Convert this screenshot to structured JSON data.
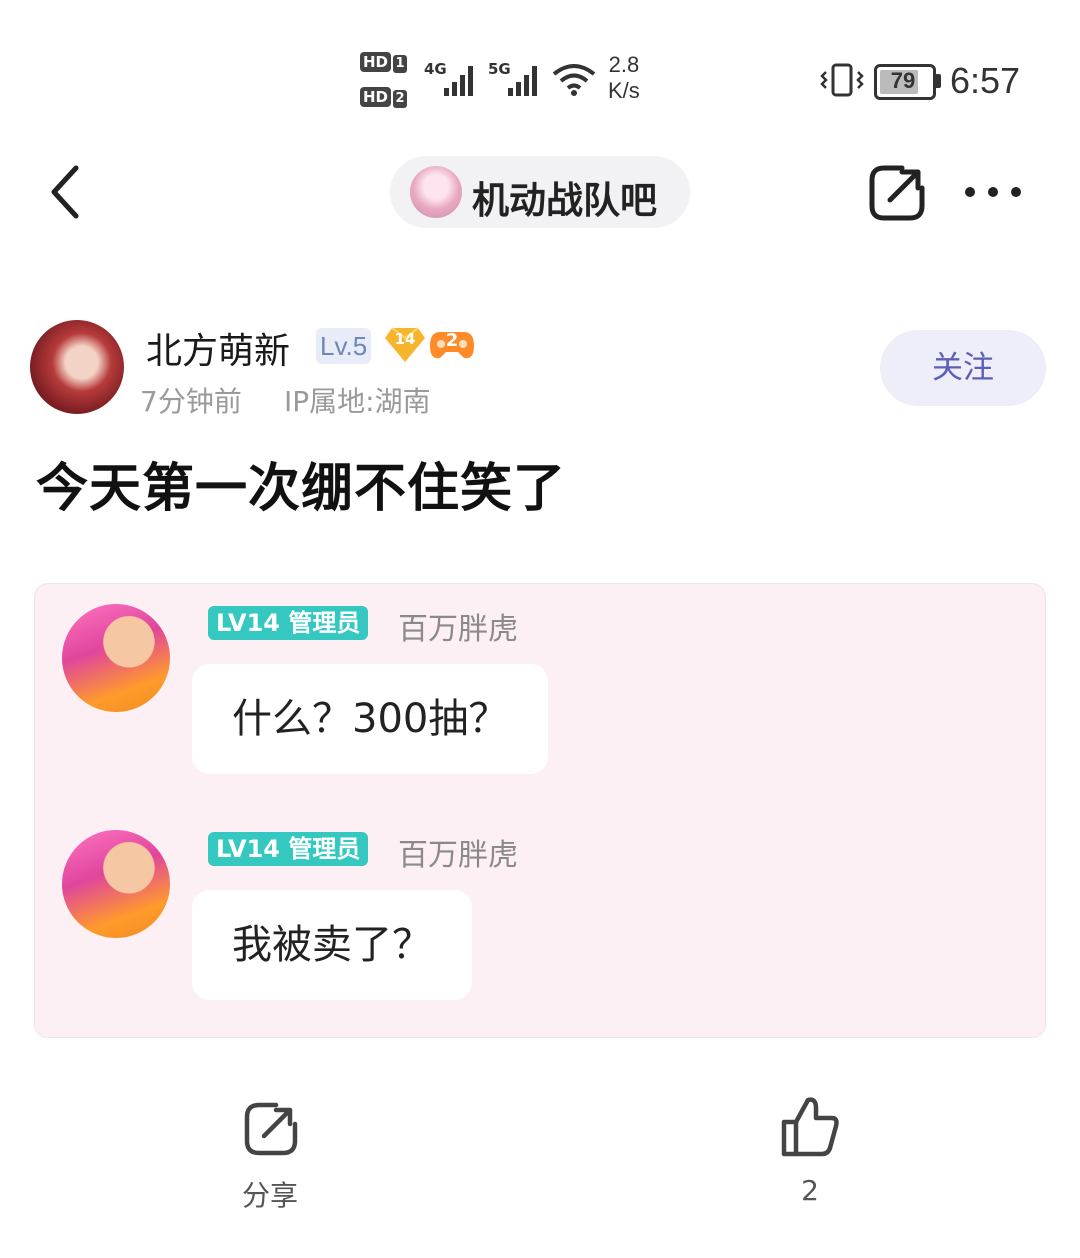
{
  "status_bar": {
    "hd1": "HD",
    "hd1_num": "1",
    "hd2": "HD",
    "hd2_num": "2",
    "net1": "4G",
    "net2": "5G",
    "speed_value": "2.8",
    "speed_unit": "K/s",
    "battery": "79",
    "time": "6:57"
  },
  "header": {
    "forum_name": "机动战队吧",
    "back_icon": "chevron-left-icon",
    "share_icon": "share-icon",
    "more_icon": "more-icon"
  },
  "post": {
    "author": "北方萌新",
    "level": "Lv.5",
    "gem_level": "14",
    "game_badge": "2",
    "time_ago": "7分钟前",
    "ip_location": "IP属地:湖南",
    "follow_label": "关注",
    "title": "今天第一次绷不住笑了"
  },
  "image": {
    "messages": [
      {
        "tag": "LV14 管理员",
        "name": "百万胖虎",
        "text": "什么？300抽？"
      },
      {
        "tag": "LV14 管理员",
        "name": "百万胖虎",
        "text": "我被卖了？"
      }
    ]
  },
  "actions": {
    "share_label": "分享",
    "like_count": "2"
  },
  "colors": {
    "accent_purple": "#5b5fb6",
    "follow_bg": "#eeeef8",
    "admin_tag": "#34c8c1",
    "card_bg": "#fdf0f4"
  }
}
